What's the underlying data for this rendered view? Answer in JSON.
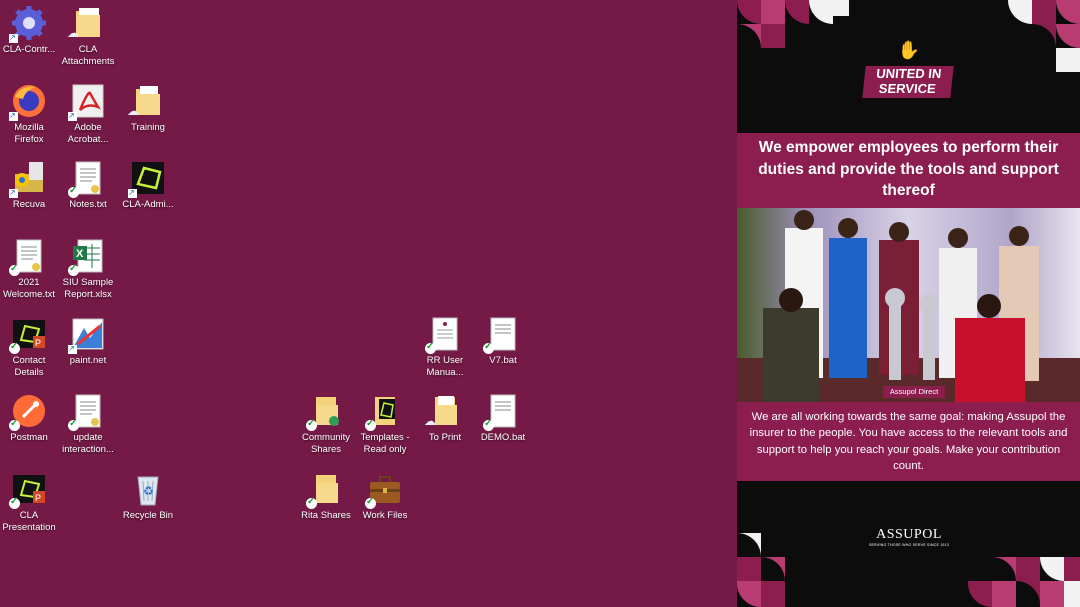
{
  "desktop": {
    "icons": [
      {
        "id": "cla-control",
        "label": "CLA-Contr..."
      },
      {
        "id": "cla-attachments",
        "label": "CLA Attachments"
      },
      {
        "id": "firefox",
        "label": "Mozilla Firefox"
      },
      {
        "id": "acrobat",
        "label": "Adobe Acrobat..."
      },
      {
        "id": "training",
        "label": "Training"
      },
      {
        "id": "recuva",
        "label": "Recuva"
      },
      {
        "id": "notes",
        "label": "Notes.txt"
      },
      {
        "id": "cla-admin",
        "label": "CLA-Admi..."
      },
      {
        "id": "welcome",
        "label": "2021 Welcome.txt"
      },
      {
        "id": "siu-report",
        "label": "SIU Sample Report.xlsx"
      },
      {
        "id": "contact-details",
        "label": "Contact Details"
      },
      {
        "id": "paintnet",
        "label": "paint.net"
      },
      {
        "id": "rr-user-manual",
        "label": "RR User Manua..."
      },
      {
        "id": "v7bat",
        "label": "V7.bat"
      },
      {
        "id": "postman",
        "label": "Postman"
      },
      {
        "id": "update-interaction",
        "label": "update interaction..."
      },
      {
        "id": "community-shares",
        "label": "Community Shares"
      },
      {
        "id": "templates",
        "label": "Templates - Read only"
      },
      {
        "id": "to-print",
        "label": "To Print"
      },
      {
        "id": "demo-bat",
        "label": "DEMO.bat"
      },
      {
        "id": "cla-presentation",
        "label": "CLA Presentation"
      },
      {
        "id": "recycle-bin",
        "label": "Recycle Bin"
      },
      {
        "id": "rita-shares",
        "label": "Rita Shares"
      },
      {
        "id": "work-files",
        "label": "Work Files"
      }
    ]
  },
  "poster": {
    "logo_text": "UNITED IN SERVICE",
    "headline": "We empower employees to perform their duties and provide the tools and support thereof",
    "photo_caption": "Assupol Direct",
    "body": "We are all working towards the same goal: making Assupol the insurer to the people. You have access to the relevant tools and support to help you reach your goals. Make your contribution count.",
    "brand_name": "ASSUPOL",
    "brand_tagline": "SERVING THOSE WHO SERVE SINCE 1913",
    "colors": {
      "brand": "#8c1d4f",
      "background": "#751a47"
    }
  }
}
